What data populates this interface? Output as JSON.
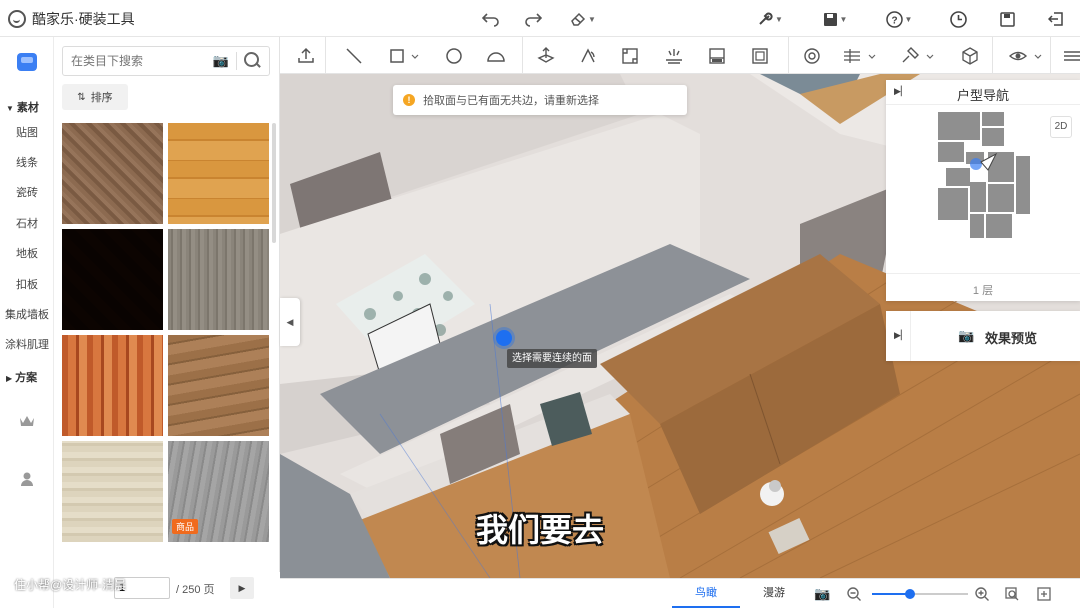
{
  "app": {
    "title": "酷家乐·硬装工具"
  },
  "rail": {
    "sections": [
      {
        "label": "素材",
        "items": [
          "贴图",
          "线条",
          "瓷砖",
          "石材",
          "地板",
          "扣板",
          "集成墙板",
          "涂料肌理"
        ]
      },
      {
        "label": "方案",
        "items": []
      }
    ]
  },
  "panel": {
    "search_placeholder": "在类目下搜索",
    "sort_label": "排序",
    "tile_badge": "商品",
    "page_value": "1",
    "page_total": "/ 250 页"
  },
  "canvas": {
    "toast": "拾取面与已有面无共边，请重新选择",
    "hint": "选择需要连续的面",
    "subtitle": "我们要去"
  },
  "navpanel": {
    "title": "户型导航",
    "zoom_label": "2D",
    "floor": "1 层"
  },
  "preview": {
    "title": "效果预览"
  },
  "bottombar": {
    "views": [
      "鸟瞰",
      "漫游"
    ],
    "active_view": "鸟瞰",
    "zoom_fraction": 0.4
  },
  "watermark": "住小帮@设计师-清晨",
  "colors": {
    "accent": "#1e6ff0",
    "warning": "#f5a623",
    "badge": "#f06b1e"
  }
}
